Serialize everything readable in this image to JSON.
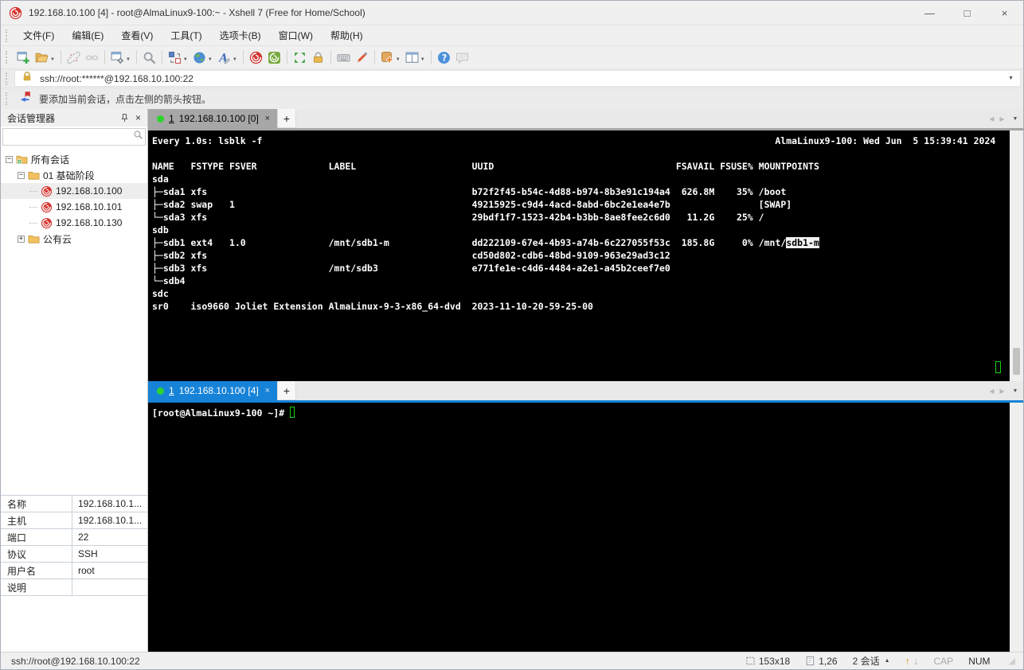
{
  "window": {
    "title": "192.168.10.100 [4] - root@AlmaLinux9-100:~ - Xshell 7 (Free for Home/School)"
  },
  "glyphs": {
    "close": "×",
    "add": "+",
    "dropdown": "▼",
    "nav_left": "◀",
    "nav_right": "▶",
    "popup": "▲",
    "up": "↑",
    "down": "↓",
    "minimize": "—",
    "maximize": "□",
    "minus": "−",
    "plus": "+",
    "grip": "◢"
  },
  "menu": {
    "items": [
      "文件(F)",
      "编辑(E)",
      "查看(V)",
      "工具(T)",
      "选项卡(B)",
      "窗口(W)",
      "帮助(H)"
    ]
  },
  "toolbar": {
    "groups": [
      [
        {
          "name": "new-session"
        },
        {
          "name": "open-folder",
          "dropdown": true
        }
      ],
      [
        {
          "name": "disconnect",
          "disabled": true
        },
        {
          "name": "reconnect",
          "disabled": true
        }
      ],
      [
        {
          "name": "session-properties",
          "dropdown": true
        }
      ],
      [
        {
          "name": "find"
        }
      ],
      [
        {
          "name": "compose-bar",
          "dropdown": true
        },
        {
          "name": "web-browser",
          "dropdown": true
        },
        {
          "name": "font",
          "dropdown": true
        }
      ],
      [
        {
          "name": "xshell"
        },
        {
          "name": "xftp"
        }
      ],
      [
        {
          "name": "fullscreen"
        },
        {
          "name": "lock-screen"
        }
      ],
      [
        {
          "name": "virtual-keyboard"
        },
        {
          "name": "highlight-pen"
        }
      ],
      [
        {
          "name": "new-session-shortcut",
          "dropdown": true
        },
        {
          "name": "tile-layout",
          "dropdown": true
        }
      ],
      [
        {
          "name": "help"
        },
        {
          "name": "feedback",
          "disabled": true
        }
      ]
    ]
  },
  "addressbar": {
    "url": "ssh://root:******@192.168.10.100:22"
  },
  "infobar": {
    "text": "要添加当前会话，点击左侧的箭头按钮。"
  },
  "session_manager": {
    "title": "会话管理器",
    "search_value": "",
    "tree": [
      {
        "label": "所有会话",
        "depth": 0,
        "icon": "folder-root",
        "expander": "minus"
      },
      {
        "label": "01 基础阶段",
        "depth": 1,
        "icon": "folder",
        "expander": "minus"
      },
      {
        "label": "192.168.10.100",
        "depth": 2,
        "icon": "session",
        "selected": true
      },
      {
        "label": "192.168.10.101",
        "depth": 2,
        "icon": "session"
      },
      {
        "label": "192.168.10.130",
        "depth": 2,
        "icon": "session"
      },
      {
        "label": "公有云",
        "depth": 1,
        "icon": "folder",
        "expander": "plus"
      }
    ]
  },
  "properties": {
    "rows": [
      {
        "label": "名称",
        "value": "192.168.10.1..."
      },
      {
        "label": "主机",
        "value": "192.168.10.1..."
      },
      {
        "label": "端口",
        "value": "22"
      },
      {
        "label": "协议",
        "value": "SSH"
      },
      {
        "label": "用户名",
        "value": "root"
      },
      {
        "label": "说明",
        "value": ""
      }
    ]
  },
  "top_pane": {
    "tab": {
      "index": "1",
      "label": "192.168.10.100 [0]"
    },
    "terminal": {
      "lines": [
        {
          "l": "Every 1.0s: lsblk -f",
          "r": "AlmaLinux9-100: Wed Jun  5 15:39:41 2024"
        },
        {
          "segs": []
        },
        {
          "segs": [
            {
              "c": 0,
              "t": "NAME"
            },
            {
              "c": 7,
              "t": "FSTYPE"
            },
            {
              "c": 14,
              "t": "FSVER"
            },
            {
              "c": 32,
              "t": "LABEL"
            },
            {
              "c": 58,
              "t": "UUID"
            },
            {
              "c": 95,
              "t": "FSAVAIL"
            },
            {
              "c": 103,
              "t": "FSUSE%"
            },
            {
              "c": 110,
              "t": "MOUNTPOINTS"
            }
          ]
        },
        {
          "segs": [
            {
              "c": 0,
              "t": "sda"
            }
          ]
        },
        {
          "segs": [
            {
              "c": 0,
              "t": "├─sda1 xfs"
            },
            {
              "c": 58,
              "t": "b72f2f45-b54c-4d88-b974-8b3e91c194a4"
            },
            {
              "c": 96,
              "t": "626.8M"
            },
            {
              "c": 106,
              "t": "35%"
            },
            {
              "c": 110,
              "t": "/boot"
            }
          ]
        },
        {
          "segs": [
            {
              "c": 0,
              "t": "├─sda2 swap"
            },
            {
              "c": 14,
              "t": "1"
            },
            {
              "c": 58,
              "t": "49215925-c9d4-4acd-8abd-6bc2e1ea4e7b"
            },
            {
              "c": 110,
              "t": "[SWAP]"
            }
          ]
        },
        {
          "segs": [
            {
              "c": 0,
              "t": "└─sda3 xfs"
            },
            {
              "c": 58,
              "t": "29bdf1f7-1523-42b4-b3bb-8ae8fee2c6d0"
            },
            {
              "c": 97,
              "t": "11.2G"
            },
            {
              "c": 106,
              "t": "25%"
            },
            {
              "c": 110,
              "t": "/"
            }
          ]
        },
        {
          "segs": [
            {
              "c": 0,
              "t": "sdb"
            }
          ]
        },
        {
          "segs": [
            {
              "c": 0,
              "t": "├─sdb1 ext4"
            },
            {
              "c": 14,
              "t": "1.0"
            },
            {
              "c": 32,
              "t": "/mnt/sdb1-m"
            },
            {
              "c": 58,
              "t": "dd222109-67e4-4b93-a74b-6c227055f53c"
            },
            {
              "c": 96,
              "t": "185.8G"
            },
            {
              "c": 107,
              "t": "0%"
            },
            {
              "c": 110,
              "t": "/mnt/"
            },
            {
              "c": 115,
              "t": "sdb1-m",
              "hl": true
            }
          ]
        },
        {
          "segs": [
            {
              "c": 0,
              "t": "├─sdb2 xfs"
            },
            {
              "c": 58,
              "t": "cd50d802-cdb6-48bd-9109-963e29ad3c12"
            }
          ]
        },
        {
          "segs": [
            {
              "c": 0,
              "t": "├─sdb3 xfs"
            },
            {
              "c": 32,
              "t": "/mnt/sdb3"
            },
            {
              "c": 58,
              "t": "e771fe1e-c4d6-4484-a2e1-a45b2ceef7e0"
            }
          ]
        },
        {
          "segs": [
            {
              "c": 0,
              "t": "└─sdb4"
            }
          ]
        },
        {
          "segs": [
            {
              "c": 0,
              "t": "sdc"
            }
          ]
        },
        {
          "segs": [
            {
              "c": 0,
              "t": "sr0"
            },
            {
              "c": 7,
              "t": "iso9660 Joliet Extension"
            },
            {
              "c": 32,
              "t": "AlmaLinux-9-3-x86_64-dvd"
            },
            {
              "c": 58,
              "t": "2023-11-10-20-59-25-00"
            }
          ]
        }
      ]
    }
  },
  "bottom_pane": {
    "tab": {
      "index": "1",
      "label": "192.168.10.100 [4]"
    },
    "terminal": {
      "prompt": "[root@AlmaLinux9-100 ~]#"
    }
  },
  "statusbar": {
    "url": "ssh://root@192.168.10.100:22",
    "size": "153x18",
    "position": "1,26",
    "sessions": "2 会话",
    "cap": "CAP",
    "num": "NUM"
  }
}
